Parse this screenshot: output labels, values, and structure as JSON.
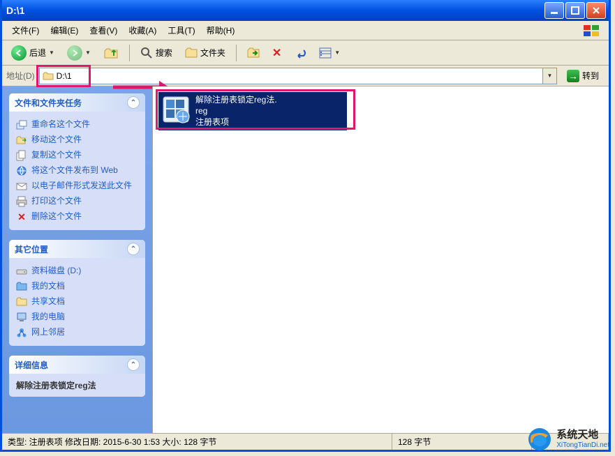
{
  "window": {
    "title": "D:\\1"
  },
  "menu": {
    "file": "文件(F)",
    "edit": "编辑(E)",
    "view": "查看(V)",
    "favorites": "收藏(A)",
    "tools": "工具(T)",
    "help": "帮助(H)"
  },
  "toolbar": {
    "back": "后退",
    "search": "搜索",
    "folders": "文件夹"
  },
  "address": {
    "label": "地址(D)",
    "value": "D:\\1",
    "go": "转到"
  },
  "sidebar": {
    "tasks": {
      "title": "文件和文件夹任务",
      "items": [
        {
          "label": "重命名这个文件",
          "icon": "rename"
        },
        {
          "label": "移动这个文件",
          "icon": "move"
        },
        {
          "label": "复制这个文件",
          "icon": "copy"
        },
        {
          "label": "将这个文件发布到 Web",
          "icon": "web"
        },
        {
          "label": "以电子邮件形式发送此文件",
          "icon": "email"
        },
        {
          "label": "打印这个文件",
          "icon": "print"
        },
        {
          "label": "删除这个文件",
          "icon": "delete"
        }
      ]
    },
    "places": {
      "title": "其它位置",
      "items": [
        {
          "label": "资料磁盘 (D:)",
          "icon": "drive"
        },
        {
          "label": "我的文档",
          "icon": "docs"
        },
        {
          "label": "共享文档",
          "icon": "folder"
        },
        {
          "label": "我的电脑",
          "icon": "computer"
        },
        {
          "label": "网上邻居",
          "icon": "network"
        }
      ]
    },
    "details": {
      "title": "详细信息",
      "filename": "解除注册表锁定reg法"
    }
  },
  "file": {
    "line1": "解除注册表锁定reg法.",
    "line2": "reg",
    "line3": "注册表项"
  },
  "status": {
    "left": "类型: 注册表项 修改日期: 2015-6-30 1:53 大小: 128 字节",
    "mid": "128 字节"
  },
  "watermark": {
    "zh": "系统天地",
    "en": "XiTongTianDi.net"
  }
}
